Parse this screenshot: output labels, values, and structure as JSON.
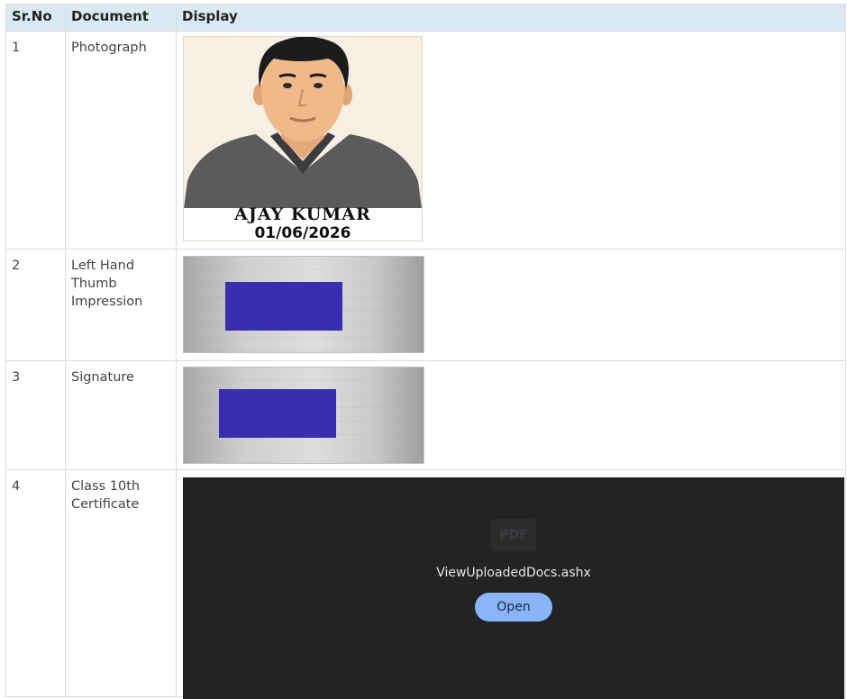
{
  "table": {
    "headers": {
      "sr_no": "Sr.No",
      "document": "Document",
      "display": "Display"
    },
    "rows": [
      {
        "sr_no": "1",
        "document": "Photograph"
      },
      {
        "sr_no": "2",
        "document": "Left Hand Thumb Impression"
      },
      {
        "sr_no": "3",
        "document": "Signature"
      },
      {
        "sr_no": "4",
        "document": "Class 10th Certificate"
      }
    ]
  },
  "photo": {
    "name": "AJAY KUMAR",
    "date": "01/06/2026"
  },
  "pdf_viewer": {
    "icon_text": "PDF",
    "file_name": "ViewUploadedDocs.ashx",
    "open_label": "Open"
  },
  "colors": {
    "header_bg": "#d9eaf4",
    "redaction": "#3a2db0",
    "viewer_bg": "#222325",
    "open_button": "#8ab4f8"
  },
  "icons": {
    "pdf": "pdf-file-icon"
  }
}
